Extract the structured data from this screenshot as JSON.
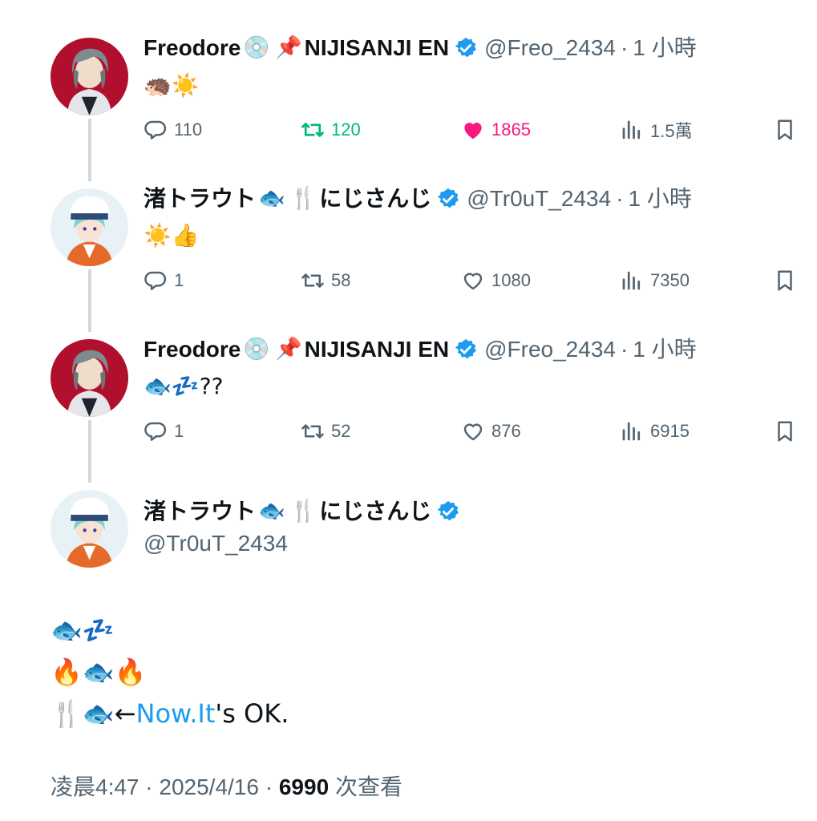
{
  "colors": {
    "reply_line": "#cfd9de",
    "verified": "#1d9bf0",
    "retweet_active": "#00ba7c",
    "like_active": "#f91880",
    "secondary_text": "#536471",
    "link": "#1d9bf0"
  },
  "tweets": [
    {
      "name": "Freodore",
      "name_emoji_1": "💿",
      "name_emoji_2": "📌",
      "affiliation": "NIJISANJI EN",
      "handle": "@Freo_2434",
      "sep": "·",
      "time": "1 小時",
      "text": "🦔☀️",
      "reply_count": "110",
      "retweet_count": "120",
      "like_count": "1865",
      "view_count": "1.5萬",
      "retweeted": true,
      "liked": true
    },
    {
      "name": "渚トラウト",
      "name_emoji_1": "🐟",
      "name_emoji_2": "🍴",
      "affiliation": "にじさんじ",
      "handle": "@Tr0uT_2434",
      "sep": "·",
      "time": "1 小時",
      "text": "☀️👍",
      "reply_count": "1",
      "retweet_count": "58",
      "like_count": "1080",
      "view_count": "7350",
      "retweeted": false,
      "liked": false
    },
    {
      "name": "Freodore",
      "name_emoji_1": "💿",
      "name_emoji_2": "📌",
      "affiliation": "NIJISANJI EN",
      "handle": "@Freo_2434",
      "sep": "·",
      "time": "1 小時",
      "text": "🐟💤??",
      "reply_count": "1",
      "retweet_count": "52",
      "like_count": "876",
      "view_count": "6915",
      "retweeted": false,
      "liked": false
    }
  ],
  "main_tweet": {
    "name": "渚トラウト",
    "name_emoji_1": "🐟",
    "name_emoji_2": "🍴",
    "affiliation": "にじさんじ",
    "handle": "@Tr0uT_2434",
    "line1": "🐟💤",
    "line2": "🔥🐟🔥",
    "line3_prefix": "🍴🐟←",
    "line3_link": "Now.It",
    "line3_suffix": "'s OK.",
    "time_text": "凌晨4:47",
    "sep": "·",
    "date": "2025/4/16",
    "views": "6990",
    "views_label": "次查看"
  },
  "icons": {
    "reply": "reply-icon",
    "retweet": "retweet-icon",
    "like": "heart-icon",
    "views": "views-icon",
    "bookmark": "bookmark-icon",
    "verified": "verified-badge-icon"
  }
}
